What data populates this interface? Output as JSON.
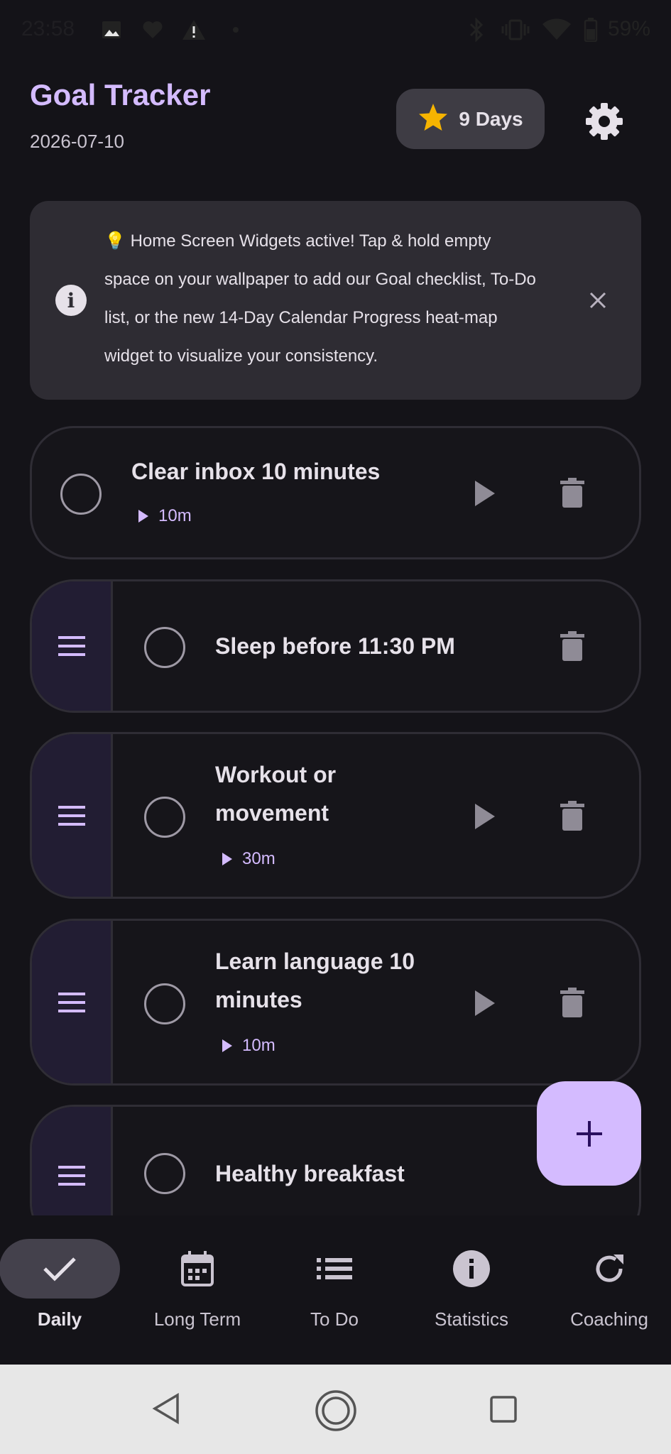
{
  "status_bar": {
    "time": "23:58",
    "battery": "59%",
    "icons": [
      "image-icon",
      "heart-icon",
      "warning-icon",
      "dot-icon",
      "bluetooth-icon",
      "vibrate-icon",
      "wifi-icon",
      "battery-icon"
    ]
  },
  "header": {
    "title": "Goal Tracker",
    "date": "2026-07-10",
    "streak_label": "9 Days",
    "streak_icon": "star-icon",
    "settings_icon": "gear-icon"
  },
  "banner": {
    "emoji": "💡",
    "text": "Home Screen Widgets active! Tap & hold empty space on your wallpaper to add our Goal checklist, To-Do list, or the new 14-Day Calendar Progress heat-map widget to visualize your consistency.",
    "close_icon": "close-icon"
  },
  "goals": [
    {
      "name": "Clear inbox 10 minutes",
      "duration": "10m"
    },
    {
      "name": "Sleep before 11:30 PM",
      "duration": ""
    },
    {
      "name": "Workout or movement",
      "duration": "30m"
    },
    {
      "name": "Learn language 10 minutes",
      "duration": "10m"
    },
    {
      "name": "Healthy breakfast",
      "duration": ""
    }
  ],
  "fab": {
    "icon": "plus-icon"
  },
  "bottom_nav": [
    {
      "label": "Daily",
      "icon": "check-icon",
      "selected": true
    },
    {
      "label": "Long Term",
      "icon": "calendar-icon",
      "selected": false
    },
    {
      "label": "To Do",
      "icon": "list-icon",
      "selected": false
    },
    {
      "label": "Statistics",
      "icon": "info-icon",
      "selected": false
    },
    {
      "label": "Coaching",
      "icon": "refresh-icon",
      "selected": false
    }
  ],
  "colors": {
    "accent": "#d4bbff",
    "background": "#141318",
    "surface": "#2e2c33",
    "star": "#f6b400"
  }
}
